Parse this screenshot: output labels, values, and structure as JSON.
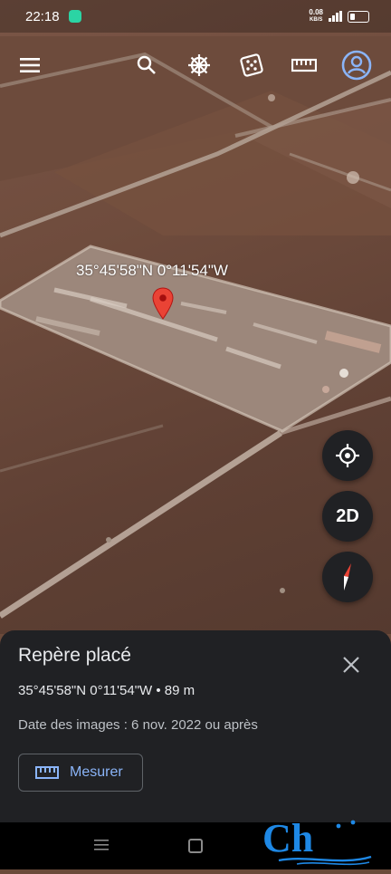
{
  "status_bar": {
    "time": "22:18",
    "net_speed_value": "0.08",
    "net_speed_unit": "KB/S",
    "app_icon": "chat-bubble-icon"
  },
  "toolbar": {
    "icons": [
      "menu-icon",
      "search-icon",
      "voyager-wheel-icon",
      "dice-icon",
      "ruler-icon",
      "account-icon"
    ]
  },
  "placemark": {
    "label": "35°45'58\"N 0°11'54\"W",
    "pin_color": "#ea4335"
  },
  "map_controls": {
    "locate_icon": "my-location-icon",
    "view_mode_label": "2D",
    "compass_icon": "compass-icon"
  },
  "sheet": {
    "title": "Repère placé",
    "coords": "35°45'58\"N 0°11'54\"W • 89 m",
    "date": "Date des images : 6 nov. 2022 ou après",
    "measure_label": "Mesurer"
  },
  "watermark": {
    "text": "Ch"
  },
  "colors": {
    "sheet_bg": "#202124",
    "accent_blue": "#8ab4f8",
    "account_blue": "#8ab4f8"
  }
}
